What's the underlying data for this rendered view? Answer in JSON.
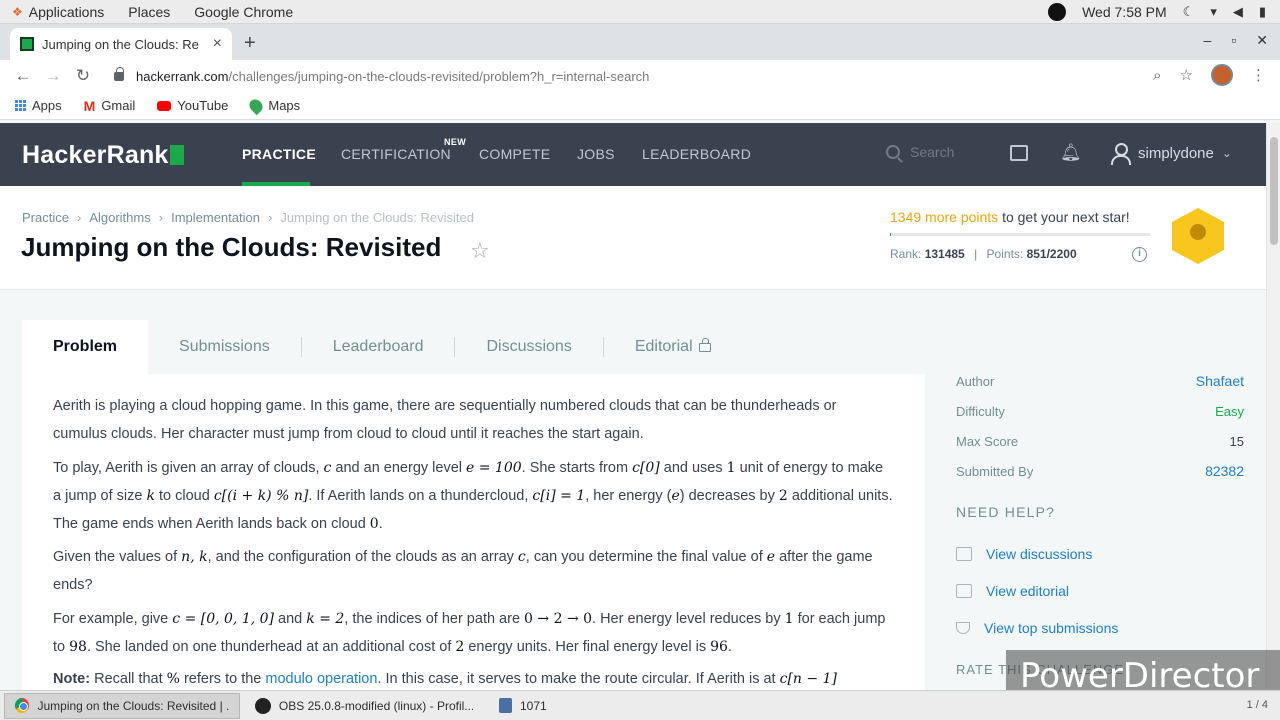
{
  "os": {
    "menus": [
      "Applications",
      "Places",
      "Google Chrome"
    ],
    "clock": "Wed  7:58 PM"
  },
  "browser": {
    "tab_title": "Jumping on the Clouds: Re",
    "new_tab": "+",
    "url_host": "hackerrank.com",
    "url_path": "/challenges/jumping-on-the-clouds-revisited/problem?h_r=internal-search",
    "bookmarks": [
      "Apps",
      "Gmail",
      "YouTube",
      "Maps"
    ]
  },
  "nav": {
    "logo": "HackerRank",
    "links": [
      "PRACTICE",
      "CERTIFICATION",
      "COMPETE",
      "JOBS",
      "LEADERBOARD"
    ],
    "new_badge": "NEW",
    "search_placeholder": "Search",
    "username": "simplydone"
  },
  "breadcrumbs": [
    "Practice",
    "Algorithms",
    "Implementation",
    "Jumping on the Clouds: Revisited"
  ],
  "challenge": {
    "title": "Jumping on the Clouds: Revisited",
    "points_needed": "1349 more points",
    "points_suffix": " to get your next star!",
    "progress_fraction": 0.004,
    "rank_label": "Rank: ",
    "rank": "131485",
    "points_label": "Points: ",
    "points": "851/2200"
  },
  "tabs": [
    "Problem",
    "Submissions",
    "Leaderboard",
    "Discussions",
    "Editorial"
  ],
  "problem": {
    "p1": "Aerith is playing a cloud hopping game. In this game, there are sequentially numbered clouds that can be thunderheads or cumulus clouds. Her character must jump from cloud to cloud until it reaches the start again.",
    "p2a": "To play, Aerith is given an array of clouds, ",
    "p2_c": "c",
    "p2b": " and an energy level ",
    "p2_e": "e = 100",
    "p2c": ". She starts from ",
    "p2_c0": "c[0]",
    "p2d": " and uses ",
    "p2_one": "1",
    "p2e": " unit of energy to make a jump of size ",
    "p2_k": "k",
    "p2f": " to cloud ",
    "p2_expr": "c[(i + k) % n]",
    "p2g": ". If Aerith lands on a thundercloud, ",
    "p2_ci": "c[i] = 1",
    "p2h": ", her energy (",
    "p2_e2": "e",
    "p2i": ") decreases by ",
    "p2_two": "2",
    "p2j": " additional units. The game ends when Aerith lands back on cloud ",
    "p2_zero": "0",
    "p2k": ".",
    "p3a": "Given the values of ",
    "p3_nk": "n, k",
    "p3b": ", and the configuration of the clouds as an array ",
    "p3_c": "c",
    "p3c": ", can you determine the final value of ",
    "p3_e": "e",
    "p3d": " after the game ends?",
    "p4a": "For example, give ",
    "p4_c": "c = [0, 0, 1, 0]",
    "p4b": " and ",
    "p4_k": "k = 2",
    "p4c": ", the indices of her path are ",
    "p4_path": "0 → 2 → 0",
    "p4d": ". Her energy level reduces by ",
    "p4_one": "1",
    "p4e": " for each jump to ",
    "p4_98": "98",
    "p4f": ". She landed on one thunderhead at an additional cost of ",
    "p4_two": "2",
    "p4g": " energy units. Her final energy level is ",
    "p4_96": "96",
    "p4h": ".",
    "note_label": "Note:",
    "note_a": " Recall that ",
    "note_pct": "%",
    "note_b": " refers to the ",
    "note_link": "modulo operation",
    "note_c": ". In this case, it serves to make the route circular. If Aerith is at ",
    "note_expr": "c[n − 1]"
  },
  "sidebar": {
    "meta": [
      {
        "key": "Author",
        "value": "Shafaet"
      },
      {
        "key": "Difficulty",
        "value": "Easy"
      },
      {
        "key": "Max Score",
        "value": "15"
      },
      {
        "key": "Submitted By",
        "value": "82382"
      }
    ],
    "need_help": "NEED HELP?",
    "help_links": [
      "View discussions",
      "View editorial",
      "View top submissions"
    ],
    "rate_label": "RATE THIS CHALLENGE"
  },
  "watermark": "PowerDirector",
  "taskbar": {
    "items": [
      "Jumping on the Clouds: Revisited | ...",
      "OBS 25.0.8-modified (linux) - Profil...",
      "1071"
    ],
    "pager": "1 / 4"
  }
}
